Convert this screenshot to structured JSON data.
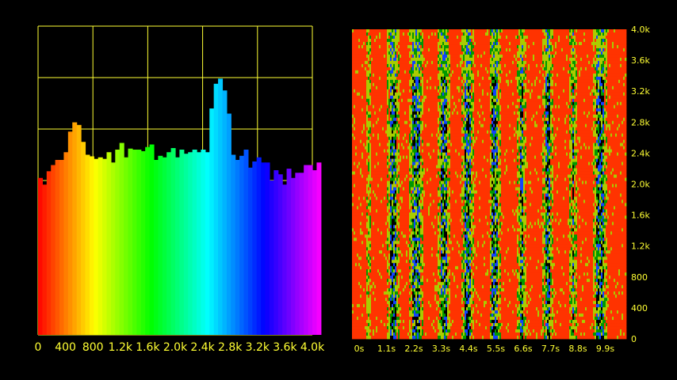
{
  "chart_data": [
    {
      "type": "bar",
      "xlim": [
        0,
        4000
      ],
      "ylim": [
        0,
        6
      ],
      "grid": true,
      "x_tick_labels": [
        "0",
        "400",
        "800",
        "1.2k",
        "1.6k",
        "2.0k",
        "2.4k",
        "2.8k",
        "3.2k",
        "3.6k",
        "4.0k"
      ],
      "bin_width": 62.5,
      "values": [
        3.05,
        2.92,
        3.18,
        3.3,
        3.4,
        3.4,
        3.55,
        3.95,
        4.13,
        4.08,
        3.75,
        3.5,
        3.47,
        3.42,
        3.45,
        3.42,
        3.55,
        3.35,
        3.6,
        3.73,
        3.45,
        3.62,
        3.6,
        3.6,
        3.57,
        3.65,
        3.7,
        3.4,
        3.48,
        3.45,
        3.55,
        3.63,
        3.45,
        3.6,
        3.52,
        3.55,
        3.6,
        3.55,
        3.6,
        3.55,
        4.4,
        4.88,
        4.98,
        4.75,
        4.3,
        3.5,
        3.4,
        3.48,
        3.6,
        3.25,
        3.37,
        3.45,
        3.35,
        3.35,
        3.0,
        3.2,
        3.12,
        2.92,
        3.23,
        3.05,
        3.15,
        3.15,
        3.3,
        3.3,
        3.2,
        3.35
      ],
      "colors": [
        "#ff0000",
        "#ffff00",
        "#00ff00",
        "#00ffff",
        "#0000ff",
        "#ff00ff"
      ]
    },
    {
      "type": "heatmap",
      "x_tick_labels": [
        "0s",
        "1.1s",
        "2.2s",
        "3.3s",
        "4.4s",
        "5.5s",
        "6.6s",
        "7.7s",
        "8.8s",
        "9.9s"
      ],
      "y_tick_labels": [
        "0",
        "400",
        "800",
        "1.2k",
        "1.6k",
        "2.0k",
        "2.4k",
        "2.8k",
        "3.2k",
        "3.6k",
        "4.0k"
      ],
      "xlim": [
        0,
        10.5
      ],
      "ylim": [
        0,
        4000
      ],
      "high_intensity_time_bands_s": [
        [
          0.0,
          0.55
        ],
        [
          0.7,
          1.35
        ],
        [
          1.8,
          2.2
        ],
        [
          2.75,
          3.3
        ],
        [
          3.75,
          4.2
        ],
        [
          4.65,
          5.25
        ],
        [
          5.7,
          6.3
        ],
        [
          6.7,
          7.3
        ],
        [
          7.7,
          8.3
        ],
        [
          8.6,
          9.25
        ],
        [
          9.8,
          10.5
        ]
      ],
      "colors": [
        "#000000",
        "#1144ff",
        "#009900",
        "#aacc00",
        "#ff3300"
      ]
    }
  ]
}
